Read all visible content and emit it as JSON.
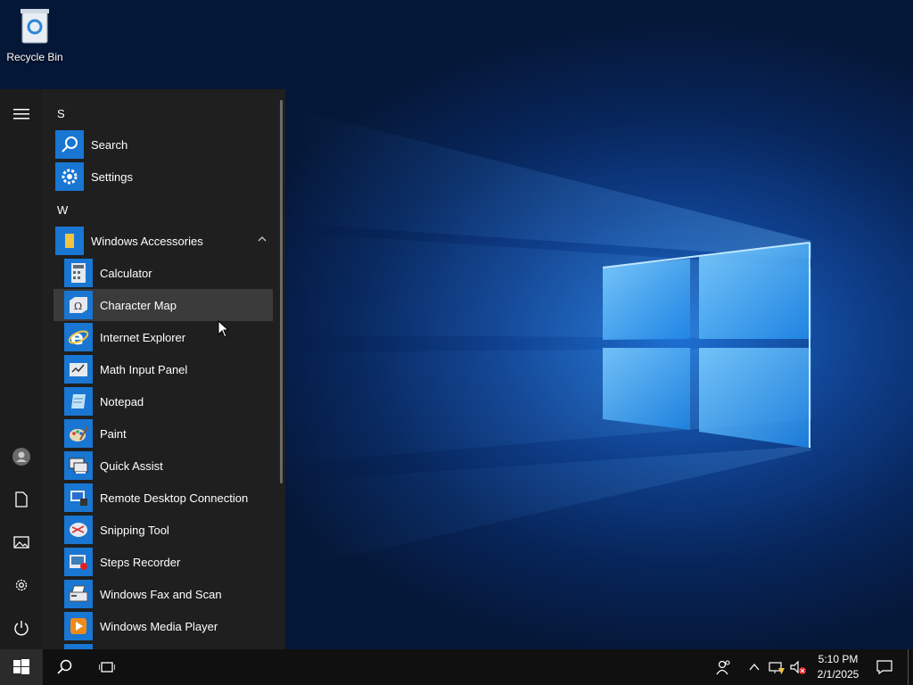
{
  "desktop": {
    "recycle_bin_label": "Recycle Bin"
  },
  "start_menu": {
    "sections": {
      "s_letter": "S",
      "w_letter": "W"
    },
    "apps_top": [
      {
        "label": "Search",
        "icon": "search-icon"
      },
      {
        "label": "Settings",
        "icon": "gear-icon"
      }
    ],
    "folder": {
      "label": "Windows Accessories",
      "icon": "folder-icon",
      "expanded": true
    },
    "accessories": [
      {
        "label": "Calculator",
        "icon": "calculator-icon"
      },
      {
        "label": "Character Map",
        "icon": "character-map-icon",
        "highlighted": true
      },
      {
        "label": "Internet Explorer",
        "icon": "internet-explorer-icon"
      },
      {
        "label": "Math Input Panel",
        "icon": "math-input-panel-icon"
      },
      {
        "label": "Notepad",
        "icon": "notepad-icon"
      },
      {
        "label": "Paint",
        "icon": "paint-icon"
      },
      {
        "label": "Quick Assist",
        "icon": "quick-assist-icon"
      },
      {
        "label": "Remote Desktop Connection",
        "icon": "remote-desktop-icon"
      },
      {
        "label": "Snipping Tool",
        "icon": "snipping-tool-icon"
      },
      {
        "label": "Steps Recorder",
        "icon": "steps-recorder-icon"
      },
      {
        "label": "Windows Fax and Scan",
        "icon": "fax-scan-icon"
      },
      {
        "label": "Windows Media Player",
        "icon": "media-player-icon"
      }
    ],
    "rail": [
      "hamburger-menu-icon",
      "user-avatar-icon",
      "documents-icon",
      "pictures-icon",
      "settings-gear-icon",
      "power-icon"
    ]
  },
  "taskbar": {
    "time": "5:10 PM",
    "date": "2/1/2025",
    "icons": [
      "windows-start-icon",
      "search-icon",
      "task-view-icon",
      "people-icon",
      "chevron-up-icon",
      "network-icon",
      "volume-muted-icon",
      "notification-icon"
    ]
  },
  "colors": {
    "accent": "#1976d2",
    "menu_bg": "#1f1f1f",
    "taskbar_bg": "#101010"
  }
}
